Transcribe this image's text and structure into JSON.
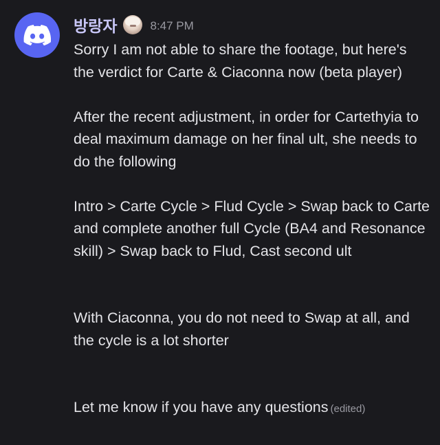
{
  "message": {
    "username": "방랑자",
    "timestamp": "8:47 PM",
    "paragraphs": [
      "Sorry I am not able to share the footage, but here's the verdict for Carte & Ciaconna now (beta player)",
      "After the recent adjustment, in order for Cartethyia to deal maximum damage on her final ult, she needs to do the following",
      "Intro > Carte Cycle > Flud Cycle > Swap back to Carte and complete another full Cycle (BA4 and Resonance skill) > Swap back to Flud, Cast second ult",
      "With Ciaconna, you do not need to Swap at all, and the cycle is a lot shorter",
      "Let me know if you have any questions"
    ],
    "edited_label": "(edited)"
  },
  "icons": {
    "avatar": "discord-logo-icon",
    "badge": "character-badge-icon"
  },
  "colors": {
    "background": "#1a1a1e",
    "avatar_bg": "#5865f2",
    "username": "#c8c6f7",
    "text": "#e4e4e8",
    "muted": "#9a9aa2"
  }
}
